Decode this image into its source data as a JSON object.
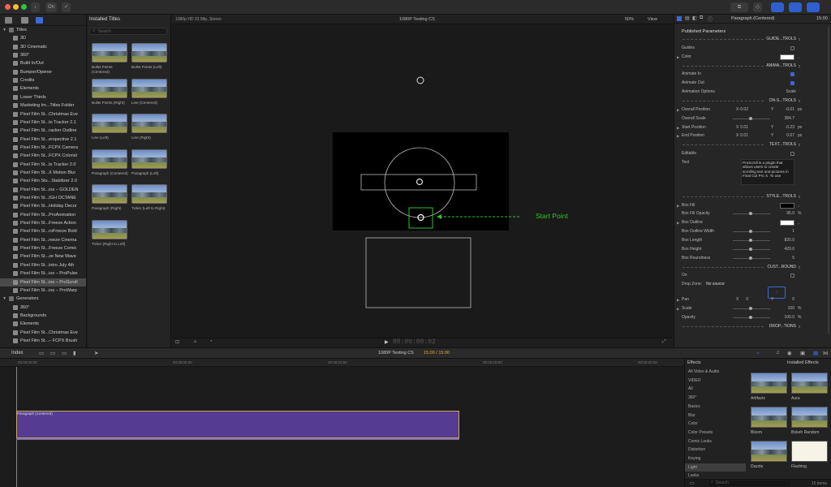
{
  "toolbar": {
    "keyword_btn": "On"
  },
  "libraries": {
    "items": [
      {
        "label": "Titles",
        "level": 0,
        "expanded": true
      },
      {
        "label": "3D",
        "level": 1
      },
      {
        "label": "3D Cinematic",
        "level": 1
      },
      {
        "label": "360°",
        "level": 1
      },
      {
        "label": "Build In/Out",
        "level": 1
      },
      {
        "label": "Bumper/Opener",
        "level": 1
      },
      {
        "label": "Credits",
        "level": 1
      },
      {
        "label": "Elements",
        "level": 1
      },
      {
        "label": "Lower Thirds",
        "level": 1
      },
      {
        "label": "Marketing Im...Titles Folder",
        "level": 1
      },
      {
        "label": "Pixel Film St...Christmas Eve",
        "level": 1
      },
      {
        "label": "Pixel Film St...to Tracker 2.1",
        "level": 1
      },
      {
        "label": "Pixel Film St...racker Outline",
        "level": 1
      },
      {
        "label": "Pixel Film St...erspective 2.1",
        "level": 1
      },
      {
        "label": "Pixel Film St...FCPX Camera",
        "level": 1
      },
      {
        "label": "Pixel Film St...FCPX Colorist",
        "level": 1
      },
      {
        "label": "Pixel Film St...ts Tracker 2.0",
        "level": 1
      },
      {
        "label": "Pixel Film St...X Motion Blur",
        "level": 1
      },
      {
        "label": "Pixel Film Stu...Stabilizer 2.0",
        "level": 1
      },
      {
        "label": "Pixel Film St...ios – GOLDEN",
        "level": 1
      },
      {
        "label": "Pixel Film St...IGH OCTANE",
        "level": 1
      },
      {
        "label": "Pixel Film St...Holiday Decor",
        "level": 1
      },
      {
        "label": "Pixel Film St...ProAnimation",
        "level": 1
      },
      {
        "label": "Pixel Film St...Freeze Action",
        "level": 1
      },
      {
        "label": "Pixel Film St...roFreeze Bold",
        "level": 1
      },
      {
        "label": "Pixel Film St...reeze Cinema",
        "level": 1
      },
      {
        "label": "Pixel Film St...Freeze Comic",
        "level": 1
      },
      {
        "label": "Pixel Film St...ze New Wave",
        "level": 1
      },
      {
        "label": "Pixel Film St...intro July 4th",
        "level": 1
      },
      {
        "label": "Pixel Film St...ios – ProPulse",
        "level": 1
      },
      {
        "label": "Pixel Film St...ios – ProScroll",
        "level": 1,
        "selected": true
      },
      {
        "label": "Pixel Film St...ios – ProWarp",
        "level": 1
      },
      {
        "label": "Generators",
        "level": 0,
        "expanded": true
      },
      {
        "label": "360°",
        "level": 1
      },
      {
        "label": "Backgrounds",
        "level": 1
      },
      {
        "label": "Elements",
        "level": 1
      },
      {
        "label": "Pixel Film St...Christmas Eve",
        "level": 1
      },
      {
        "label": "Pixel Film St...– FCPX Brush",
        "level": 1
      }
    ]
  },
  "browser": {
    "title": "Installed Titles",
    "search_placeholder": "Search",
    "thumbs": [
      {
        "caption": "Bullet Points (Centered)"
      },
      {
        "caption": "Bullet Points (Left)"
      },
      {
        "caption": "Bullet Points (Right)"
      },
      {
        "caption": "Line (Centered)"
      },
      {
        "caption": "Line (Left)"
      },
      {
        "caption": "Line (Right)"
      },
      {
        "caption": "Paragraph (Centered)"
      },
      {
        "caption": "Paragraph (Left)"
      },
      {
        "caption": "Paragraph (Right)"
      },
      {
        "caption": "Ticker (Left to Right)"
      },
      {
        "caption": "Ticker (Right to Left)"
      }
    ]
  },
  "viewer": {
    "format": "1080p HD 23.98p, Stereo",
    "project": "1080P Testing CS",
    "zoom": "50%",
    "view": "View",
    "annotation": "Start Point",
    "timecode": "00:00:00:02"
  },
  "inspector": {
    "title": "Paragraph (Centered)",
    "duration": "15:00",
    "section": "Published Parameters",
    "rows": [
      {
        "type": "header",
        "label": "GUIDE...TROLS"
      },
      {
        "type": "check",
        "label": "Guides",
        "on": false
      },
      {
        "type": "color",
        "label": "Color",
        "color": "#ffffff",
        "tri": true
      },
      {
        "type": "header",
        "label": "ANIMA...TROLS"
      },
      {
        "type": "check",
        "label": "Animate In",
        "on": true
      },
      {
        "type": "check",
        "label": "Animate Out",
        "on": true
      },
      {
        "type": "value",
        "label": "Animation Options",
        "value": "Scale"
      },
      {
        "type": "header",
        "label": "ON-S...TROLS"
      },
      {
        "type": "xy",
        "label": "Overall Position",
        "x": "-0.02",
        "y": "-0.01",
        "unit": "px",
        "tri": true
      },
      {
        "type": "slider",
        "label": "Overall Scale",
        "value": "384.7"
      },
      {
        "type": "xy",
        "label": "Start Position",
        "x": "0.01",
        "y": "-0.23",
        "unit": "px",
        "tri": true
      },
      {
        "type": "xy",
        "label": "End Position",
        "x": "0.01",
        "y": "0.67",
        "unit": "px",
        "tri": true
      },
      {
        "type": "header",
        "label": "TEXT...TROLS"
      },
      {
        "type": "check",
        "label": "Editable",
        "on": false
      },
      {
        "type": "text",
        "label": "Text",
        "value": "ProScroll is a plugin that allows users to create scrolling text and pictures in Final Cut Pro X. To use"
      },
      {
        "type": "header",
        "label": "STYLE...TROLS"
      },
      {
        "type": "color",
        "label": "Box Fill",
        "color": "#000000",
        "tri": true
      },
      {
        "type": "slider",
        "label": "Box Fill Opacity",
        "value": "95.0",
        "unit": "%"
      },
      {
        "type": "color",
        "label": "Box Outline",
        "color": "#ffffff",
        "tri": true
      },
      {
        "type": "slider",
        "label": "Box Outline Width",
        "value": "1"
      },
      {
        "type": "slider",
        "label": "Box Length",
        "value": "820.0"
      },
      {
        "type": "slider",
        "label": "Box Height",
        "value": "420.0"
      },
      {
        "type": "slider",
        "label": "Box Roundness",
        "value": "5"
      },
      {
        "type": "header",
        "label": "CUST...ROUND"
      },
      {
        "type": "check",
        "label": "On",
        "on": false
      },
      {
        "type": "drop",
        "label": "Drop Zone:",
        "value": "No source"
      },
      {
        "type": "xy",
        "label": "Pan",
        "x": "0",
        "y": "0",
        "unit": "",
        "tri": true
      },
      {
        "type": "slider",
        "label": "Scale",
        "value": "100",
        "unit": "%",
        "tri": true
      },
      {
        "type": "slider",
        "label": "Opacity",
        "value": "100.0",
        "unit": "%"
      },
      {
        "type": "header",
        "label": "DROP...TIONS"
      }
    ]
  },
  "timeline": {
    "index_label": "Index",
    "project": "1080P Testing CS",
    "time": "15:00 / 15:00",
    "ticks": [
      "00:00:00:00",
      "00:00:05:00",
      "00:00:10:00",
      "00:00:15:00",
      "00:00:20:00"
    ],
    "clip_label": "Paragraph (Centered)"
  },
  "effects": {
    "title": "Effects",
    "installed": "Installed Effects",
    "categories": [
      "All Video & Audio",
      "VIDEO",
      "All",
      "360°",
      "Basics",
      "Blur",
      "Color",
      "Color Presets",
      "Comic Looks",
      "Distortion",
      "Keying",
      "Light",
      "Looks"
    ],
    "selected_category": "Light",
    "items": [
      "Artifacts",
      "Aura",
      "Bloom",
      "Bokeh Random",
      "Dazzle",
      "Flashing"
    ],
    "count": "15 items",
    "search_placeholder": "Search"
  }
}
